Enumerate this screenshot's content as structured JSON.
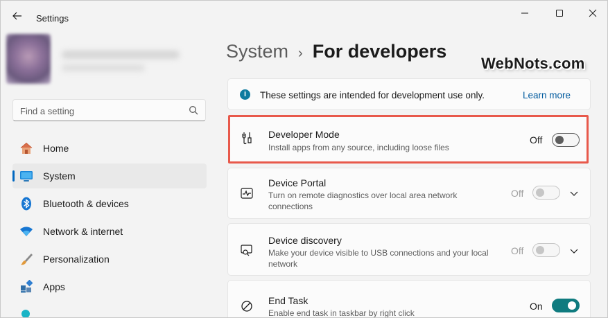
{
  "window": {
    "title": "Settings"
  },
  "sidebar": {
    "search_placeholder": "Find a setting",
    "items": [
      {
        "label": "Home",
        "icon": "home-icon"
      },
      {
        "label": "System",
        "icon": "system-icon",
        "active": true
      },
      {
        "label": "Bluetooth & devices",
        "icon": "bluetooth-icon"
      },
      {
        "label": "Network & internet",
        "icon": "wifi-icon"
      },
      {
        "label": "Personalization",
        "icon": "brush-icon"
      },
      {
        "label": "Apps",
        "icon": "apps-icon"
      }
    ]
  },
  "breadcrumb": {
    "parent": "System",
    "separator": "›",
    "current": "For developers"
  },
  "watermark": "WebNots.com",
  "info": {
    "text": "These settings are intended for development use only.",
    "link": "Learn more"
  },
  "settings": [
    {
      "title": "Developer Mode",
      "description": "Install apps from any source, including loose files",
      "state": "Off",
      "toggle": "off",
      "icon": "developer-tools-icon",
      "highlighted": true
    },
    {
      "title": "Device Portal",
      "description": "Turn on remote diagnostics over local area network connections",
      "state": "Off",
      "toggle": "disabled",
      "icon": "diagnostics-icon",
      "expandable": true
    },
    {
      "title": "Device discovery",
      "description": "Make your device visible to USB connections and your local network",
      "state": "Off",
      "toggle": "disabled",
      "icon": "device-discovery-icon",
      "expandable": true
    },
    {
      "title": "End Task",
      "description": "Enable end task in taskbar by right click",
      "state": "On",
      "toggle": "on",
      "icon": "end-task-icon"
    }
  ],
  "colors": {
    "accent": "#0067c0",
    "toggle_on": "#0f7b7f",
    "highlight_border": "#e8594b",
    "link": "#005a9e"
  }
}
